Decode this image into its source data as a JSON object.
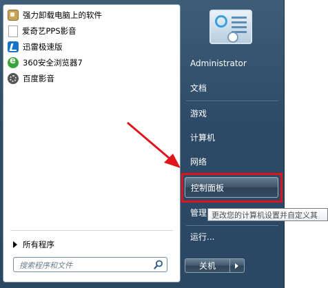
{
  "programs": [
    {
      "label": "强力卸载电脑上的软件",
      "icon": "uninstall-icon"
    },
    {
      "label": "爱奇艺PPS影音",
      "icon": "file-icon"
    },
    {
      "label": "迅雷极速版",
      "icon": "xunlei-icon"
    },
    {
      "label": "360安全浏览器7",
      "icon": "browser-360-icon"
    },
    {
      "label": "百度影音",
      "icon": "baidu-player-icon"
    }
  ],
  "all_programs_label": "所有程序",
  "search": {
    "placeholder": "搜索程序和文件"
  },
  "right_pane": {
    "user": "Administrator",
    "documents": "文档",
    "games": "游戏",
    "computer": "计算机",
    "network": "网络",
    "control_panel": "控制面板",
    "management": "管理",
    "run": "运行..."
  },
  "tooltip": "更改您的计算机设置并自定义其",
  "shutdown_label": "关机",
  "colors": {
    "highlight": "#e0141c",
    "arrow": "#e0141c",
    "menu_bg": "#2c4a66"
  }
}
